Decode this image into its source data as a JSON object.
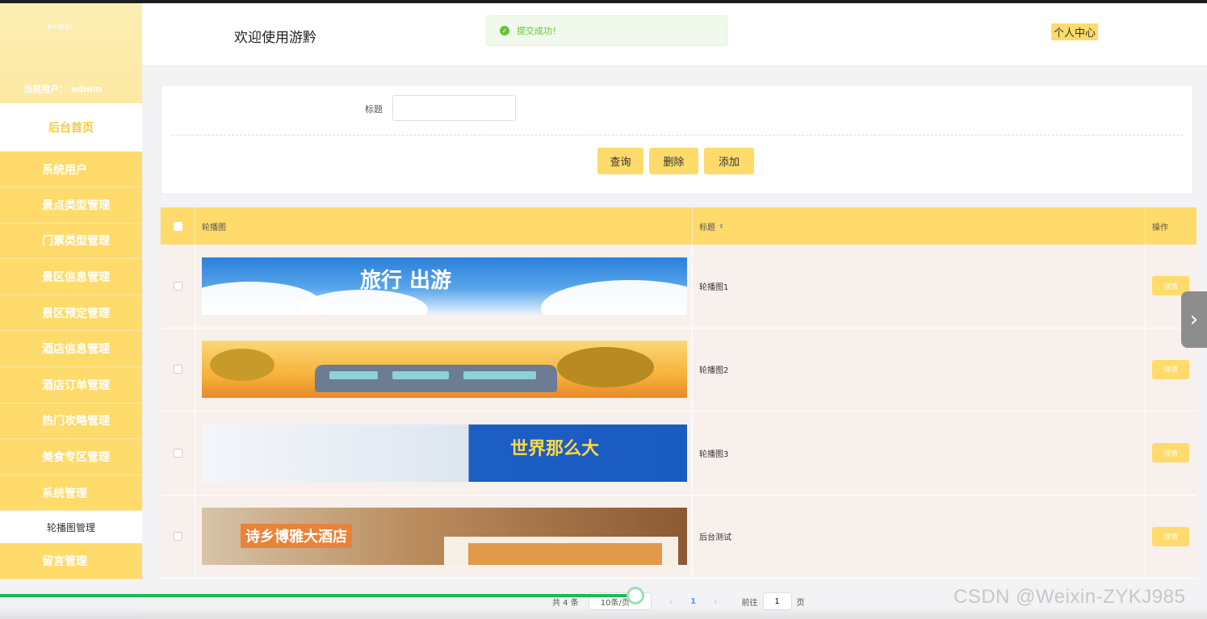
{
  "sidebar": {
    "avatar_alt": "avatar",
    "current_user": "当前用户：  admin",
    "home": "后台首页",
    "menu": [
      "系统用户",
      "景点类型管理",
      "门票类型管理",
      "景区信息管理",
      "景区预定管理",
      "酒店信息管理",
      "酒店订单管理",
      "热门攻略管理",
      "美食专区管理",
      "系统管理"
    ],
    "submenu_active": "轮播图管理",
    "last_menu": "留言管理"
  },
  "header": {
    "welcome": "欢迎使用游黔",
    "toast": "提交成功！",
    "personal_center": "个人中心"
  },
  "search": {
    "title_label": "标题",
    "title_value": "",
    "buttons": {
      "query": "查询",
      "delete": "删除",
      "add": "添加"
    }
  },
  "table": {
    "columns": {
      "image": "轮播图",
      "title": "标题",
      "actions": "操作"
    },
    "rows": [
      {
        "title": "轮播图1",
        "action": "详情",
        "banner_text": "旅行  出游"
      },
      {
        "title": "轮播图2",
        "action": "详情",
        "banner_text": ""
      },
      {
        "title": "轮播图3",
        "action": "详情",
        "banner_text": "世界那么大"
      },
      {
        "title": "后台测试",
        "action": "详情",
        "banner_text": "诗乡博雅大酒店"
      }
    ]
  },
  "pagination": {
    "total": "共 4 条",
    "page_size": "10条/页",
    "current_page": "1",
    "goto_label": "前往",
    "goto_value": "1",
    "page_suffix": "页"
  },
  "watermark": "CSDN @Weixin-ZYKJ985",
  "colors": {
    "accent": "#fedb6a",
    "success": "#67c23a",
    "row_bg": "#f8f0ec"
  }
}
